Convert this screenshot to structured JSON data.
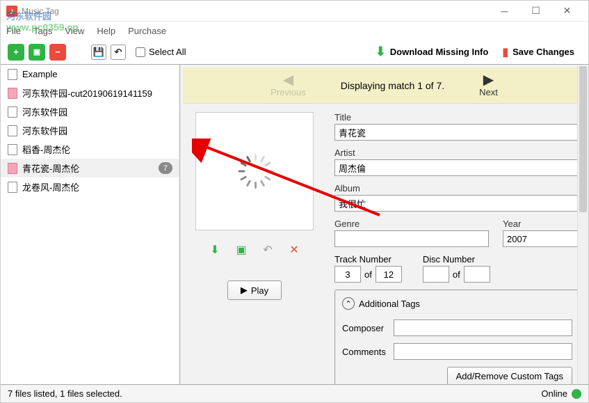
{
  "window": {
    "title": "Music Tag"
  },
  "menu": {
    "file": "File",
    "tags": "Tags",
    "view": "View",
    "help": "Help",
    "purchase": "Purchase"
  },
  "toolbar": {
    "selectall": "Select All",
    "download": "Download Missing Info",
    "save": "Save Changes"
  },
  "files": [
    {
      "name": "Example",
      "pink": false
    },
    {
      "name": "河东软件园-cut20190619141159",
      "pink": true
    },
    {
      "name": "河东软件园",
      "pink": false
    },
    {
      "name": "河东软件园",
      "pink": false
    },
    {
      "name": "稻香-周杰伦",
      "pink": false
    },
    {
      "name": "青花瓷-周杰伦",
      "pink": true,
      "selected": true,
      "badge": "7"
    },
    {
      "name": "龙卷风-周杰伦",
      "pink": false
    }
  ],
  "match": {
    "prev": "Previous",
    "text": "Displaying match 1 of 7.",
    "next": "Next"
  },
  "play": "Play",
  "labels": {
    "title": "Title",
    "artist": "Artist",
    "album": "Album",
    "genre": "Genre",
    "year": "Year",
    "track": "Track Number",
    "disc": "Disc Number",
    "of": "of",
    "additional": "Additional Tags",
    "composer": "Composer",
    "comments": "Comments",
    "custom": "Add/Remove Custom Tags"
  },
  "tags": {
    "title": "青花瓷",
    "artist": "周杰倫",
    "album": "我很忙",
    "genre": "",
    "year": "2007",
    "track_num": "3",
    "track_total": "12",
    "disc_num": "",
    "disc_total": "",
    "composer": "",
    "comments": ""
  },
  "status": {
    "text": "7 files listed, 1 files selected.",
    "online": "Online"
  },
  "watermark": {
    "text": "河东软件园",
    "url": "www.pc0359.cn"
  }
}
